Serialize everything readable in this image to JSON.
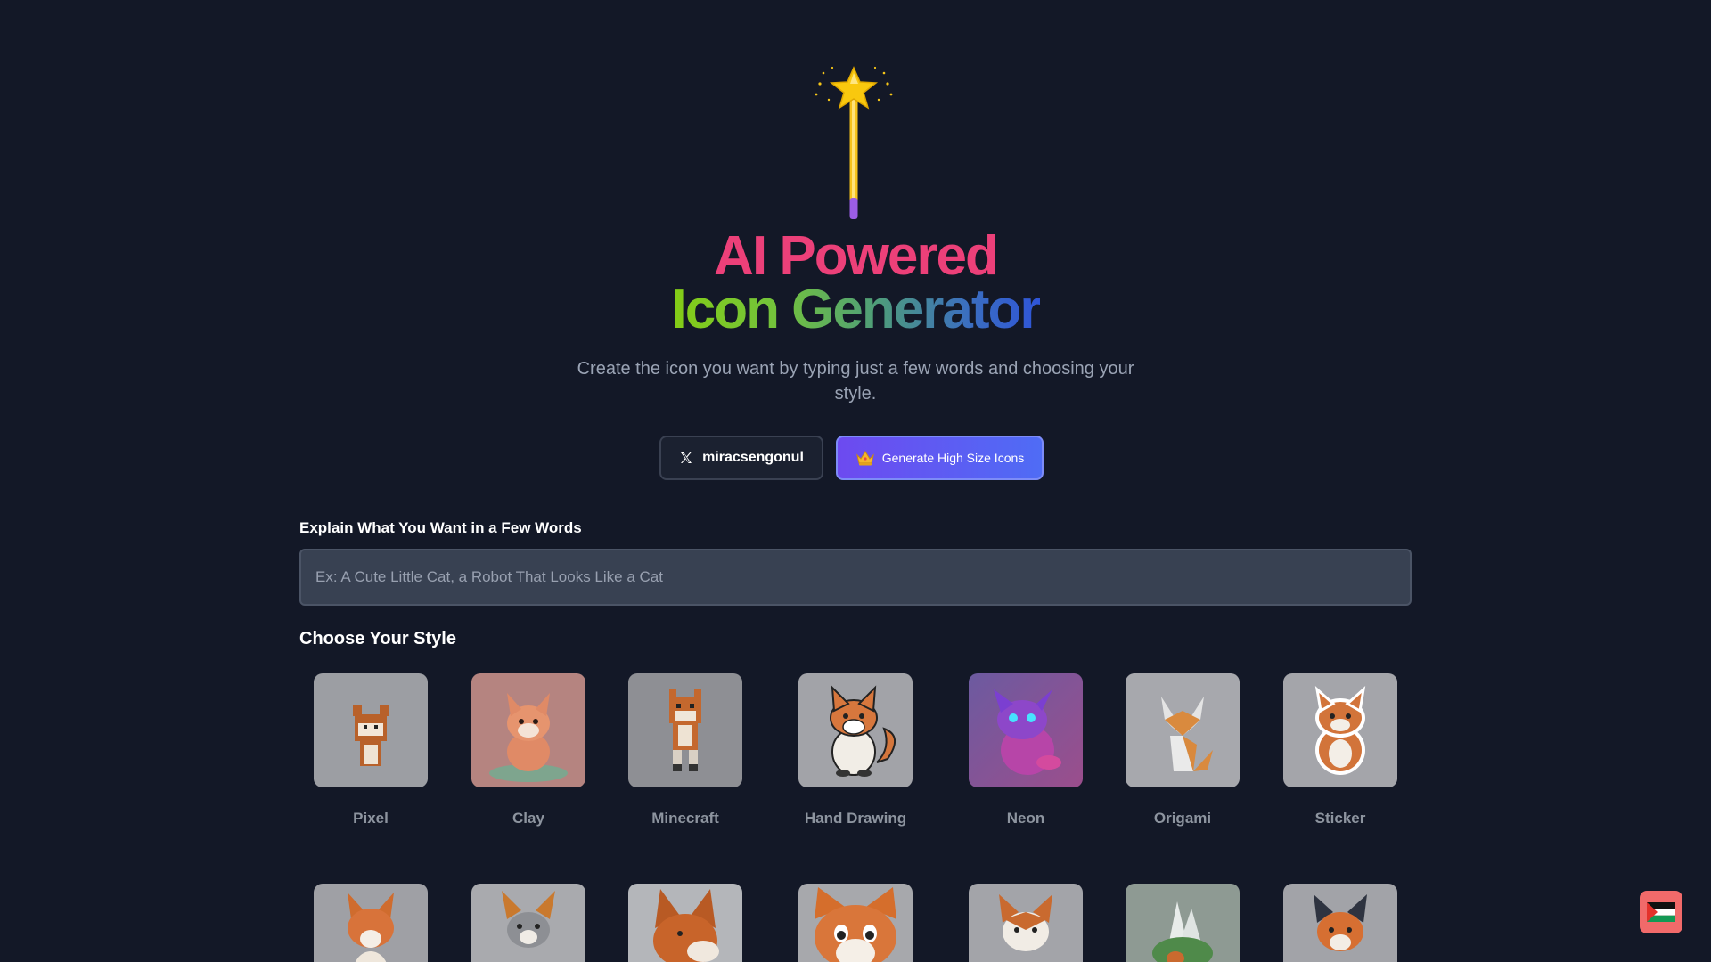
{
  "hero": {
    "title_line1": "AI Powered",
    "title_line2": "Icon Generator",
    "subtitle": "Create the icon you want by typing just a few words and choosing your style."
  },
  "buttons": {
    "twitter_handle": "miracsengonul",
    "twitter_icon": "x-logo-icon",
    "premium_label": "Generate High Size Icons",
    "premium_icon": "crown-icon"
  },
  "prompt": {
    "label": "Explain What You Want in a Few Words",
    "placeholder": "Ex: A Cute Little Cat, a Robot That Looks Like a Cat",
    "value": ""
  },
  "styles": {
    "label": "Choose Your Style",
    "row1": [
      "Pixel",
      "Clay",
      "Minecraft",
      "Hand Drawing",
      "Neon",
      "Origami",
      "Sticker"
    ],
    "row2_count_visible": 7
  },
  "colors": {
    "background": "#131827",
    "title_pink": "#ec4079",
    "gradient_start": "#84cc16",
    "gradient_end": "#2f55d8",
    "premium_button": "#6d4af0",
    "flag_button": "#f16a6a"
  },
  "floating": {
    "icon": "palestine-flag-icon"
  }
}
